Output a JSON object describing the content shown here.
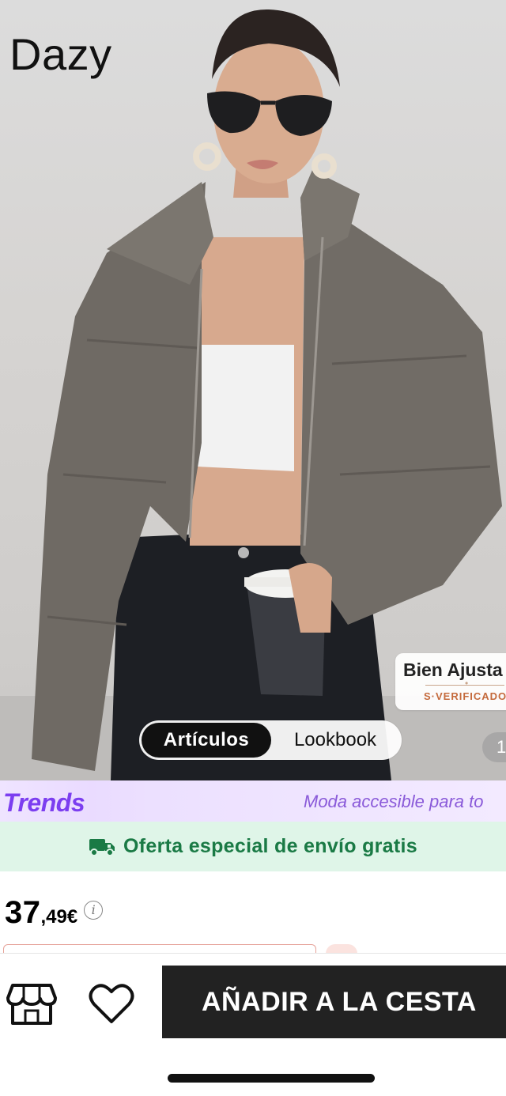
{
  "product": {
    "brand": "Dazy",
    "fit_badge": {
      "title": "Bien Ajusta",
      "subtitle": "S·VERIFICADO"
    },
    "view_switch": {
      "active": "Artículos",
      "inactive": "Lookbook"
    },
    "image_counter": "1",
    "price": {
      "integer": "37",
      "decimal": ",49€",
      "info_icon": "info-icon"
    }
  },
  "trends": {
    "logo": "Trends",
    "tagline": "Moda accesible para to"
  },
  "shipping": {
    "icon": "truck-icon",
    "text": "Oferta especial de envío gratis"
  },
  "action_bar": {
    "store_icon": "store-icon",
    "favorite_icon": "heart-icon",
    "add_to_cart": "AÑADIR A LA CESTA"
  },
  "colors": {
    "trends_purple": "#7c3ef0",
    "shipping_green": "#1a7a45",
    "shipping_bg": "#dff5e8",
    "cart_button": "#222222"
  }
}
